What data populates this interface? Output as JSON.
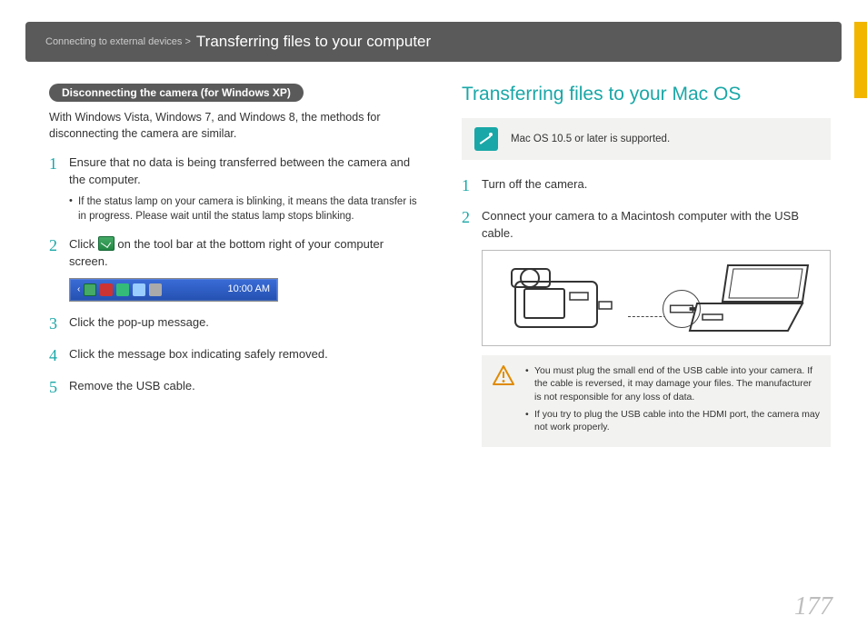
{
  "header": {
    "breadcrumb": "Connecting to external devices >",
    "title": "Transferring files to your computer"
  },
  "left": {
    "pill": "Disconnecting the camera (for Windows XP)",
    "lead": "With Windows Vista, Windows 7, and Windows 8, the methods for disconnecting the camera are similar.",
    "steps": [
      {
        "n": "1",
        "text": "Ensure that no data is being transferred between the camera and the computer.",
        "sub": "If the status lamp on your camera is blinking, it means the data transfer is in progress. Please wait until the status lamp stops blinking."
      },
      {
        "n": "2",
        "text_pre": "Click ",
        "text_post": " on the tool bar at the bottom right of your computer screen.",
        "taskbar_time": "10:00 AM"
      },
      {
        "n": "3",
        "text": "Click the pop-up message."
      },
      {
        "n": "4",
        "text": "Click the message box indicating safely removed."
      },
      {
        "n": "5",
        "text": "Remove the USB cable."
      }
    ]
  },
  "right": {
    "heading": "Transferring files to your Mac OS",
    "note": "Mac OS 10.5 or later is supported.",
    "steps": [
      {
        "n": "1",
        "text": "Turn off the camera."
      },
      {
        "n": "2",
        "text": "Connect your camera to a Macintosh computer with the USB cable."
      }
    ],
    "warn": [
      "You must plug the small end of the USB cable into your camera. If the cable is reversed, it may damage your files. The manufacturer is not responsible for any loss of data.",
      "If you try to plug the USB cable into the HDMI port, the camera may not work properly."
    ]
  },
  "page_number": "177"
}
